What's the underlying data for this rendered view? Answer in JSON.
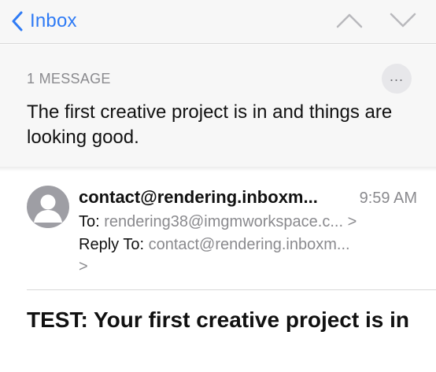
{
  "navbar": {
    "back_label": "Inbox",
    "icons": {
      "back": "chevron-left-icon",
      "previous": "chevron-up-icon",
      "next": "chevron-down-icon"
    }
  },
  "thread": {
    "message_count": "1 MESSAGE",
    "more_icon": "ellipsis-icon",
    "more_glyph": "...",
    "subject": "The first creative project is in and things are looking good."
  },
  "message": {
    "sender": "contact@rendering.inboxm...",
    "time": "9:59 AM",
    "to_label": "To:",
    "to_value": "rendering38@imgmworkspace.c... >",
    "reply_to_label": "Reply To:",
    "reply_to_value": "contact@rendering.inboxm...",
    "reply_chevron": ">",
    "subject": "TEST: Your first creative project is in"
  },
  "colors": {
    "accent": "#2f7bf5",
    "secondary_text": "#8a8a8e",
    "header_bg": "#f7f7f7",
    "avatar_bg": "#9e9ea4"
  }
}
